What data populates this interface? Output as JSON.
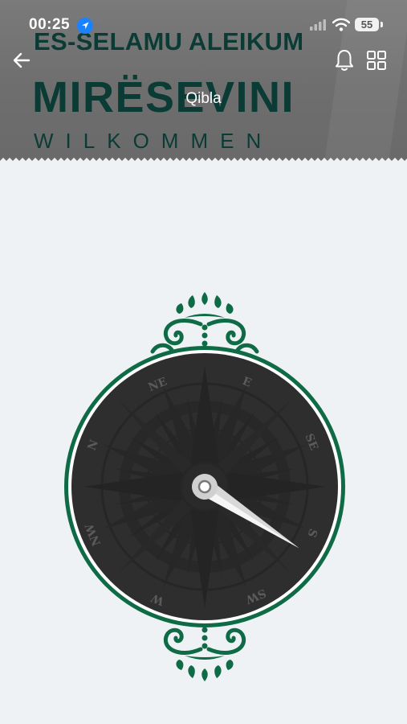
{
  "status_bar": {
    "time": "00:25",
    "battery": "55"
  },
  "banner": {
    "line1": "ES-SELAMU ALEIKUM",
    "line2": "MIRËSEVINI",
    "line3": "WILKOMMEN"
  },
  "nav": {
    "title": "Qibla"
  },
  "compass": {
    "directions": {
      "n": "N",
      "ne": "NE",
      "e": "E",
      "se": "SE",
      "s": "S",
      "sw": "SW",
      "w": "W",
      "nw": "NW"
    },
    "needle_heading_deg": 123
  },
  "colors": {
    "accent_green": "#0e6b45",
    "dial": "#2e2e2e",
    "header": "#737373",
    "background": "#eef2f5"
  }
}
